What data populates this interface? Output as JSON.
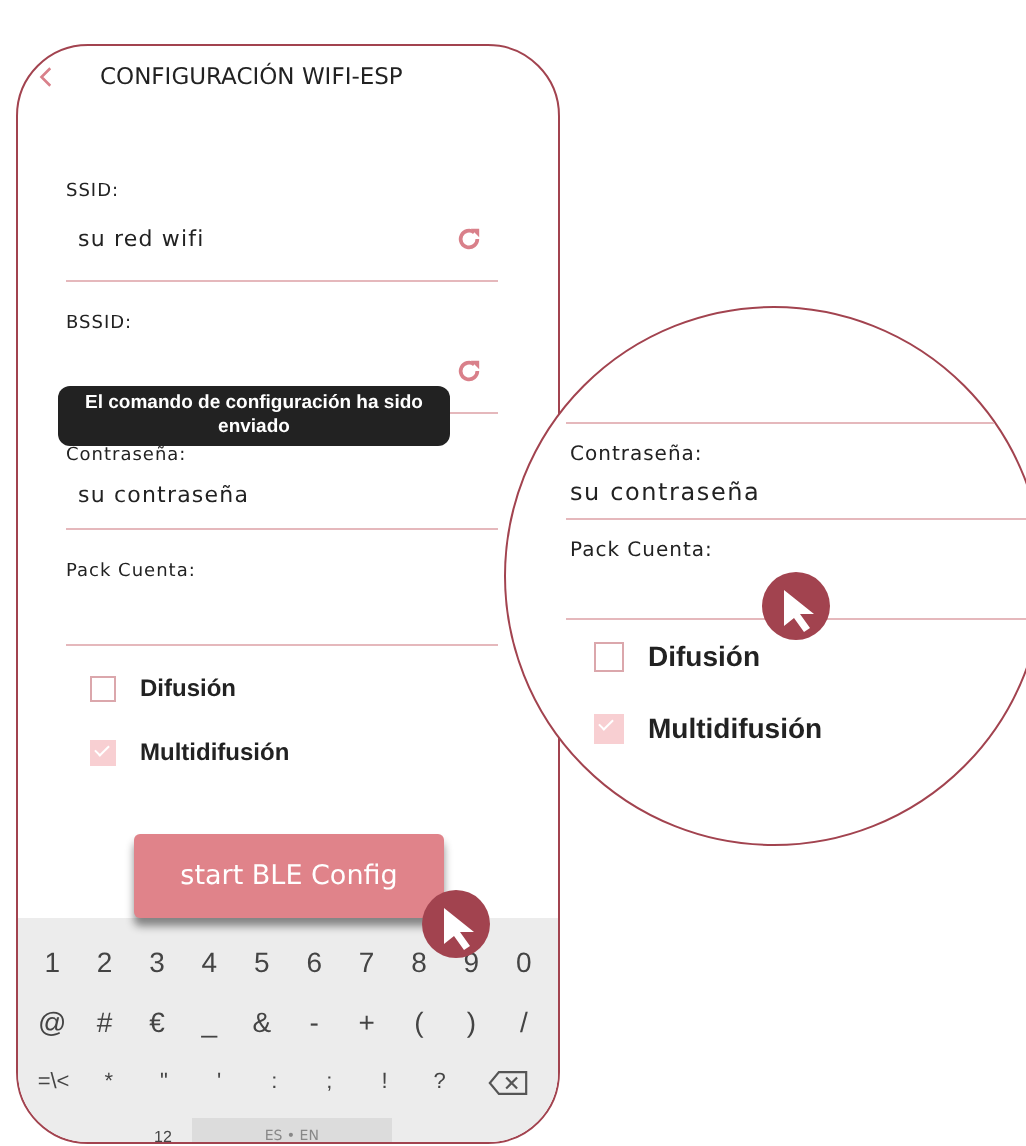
{
  "header": {
    "title": "CONFIGURACIÓN WIFI-ESP"
  },
  "fields": [
    {
      "kind": "scan",
      "label": "SSID:",
      "value": "su red wifi"
    },
    {
      "kind": "scan",
      "label": "BSSID:"
    },
    {
      "kind": "text",
      "label": "Contraseña:",
      "value": "su contraseña"
    },
    {
      "kind": "text",
      "label": "Pack Cuenta:"
    }
  ],
  "toast": "El comando de configuración ha sido enviado",
  "checkboxes": [
    {
      "label": "Difusión",
      "checked": false
    },
    {
      "label": "Multidifusión",
      "checked": true
    }
  ],
  "button": "start BLE Config",
  "keyboard": {
    "rows": [
      [
        {
          "kind": "char",
          "label": "1"
        },
        {
          "kind": "char",
          "label": "2"
        },
        {
          "kind": "char",
          "label": "3"
        },
        {
          "kind": "char",
          "label": "4"
        },
        {
          "kind": "char",
          "label": "5"
        },
        {
          "kind": "char",
          "label": "6"
        },
        {
          "kind": "char",
          "label": "7"
        },
        {
          "kind": "char",
          "label": "8"
        },
        {
          "kind": "char",
          "label": "9"
        },
        {
          "kind": "char",
          "label": "0"
        }
      ],
      [
        {
          "kind": "char",
          "label": "@"
        },
        {
          "kind": "char",
          "label": "#"
        },
        {
          "kind": "char",
          "label": "€"
        },
        {
          "kind": "char",
          "label": "_"
        },
        {
          "kind": "char",
          "label": "&"
        },
        {
          "kind": "char",
          "label": "-"
        },
        {
          "kind": "char",
          "label": "+"
        },
        {
          "kind": "char",
          "label": "("
        },
        {
          "kind": "char",
          "label": ")"
        },
        {
          "kind": "char",
          "label": "/"
        }
      ],
      [
        {
          "kind": "char",
          "label": "=\\<"
        },
        {
          "kind": "char",
          "label": "*"
        },
        {
          "kind": "char",
          "label": "\""
        },
        {
          "kind": "char",
          "label": "'"
        },
        {
          "kind": "char",
          "label": ":"
        },
        {
          "kind": "char",
          "label": ";"
        },
        {
          "kind": "char",
          "label": "!"
        },
        {
          "kind": "char",
          "label": "?"
        },
        {
          "kind": "backspace"
        }
      ]
    ],
    "bottom_keys": [
      {
        "kind": "char",
        "label": "12"
      },
      {
        "kind": "space",
        "label": "ES • EN"
      }
    ]
  },
  "magnifier": {
    "fields": [
      {
        "label": "Contraseña:",
        "value": "su contraseña"
      },
      {
        "label": "Pack Cuenta:"
      }
    ],
    "checkboxes": [
      {
        "label": "Difusión",
        "checked": false
      },
      {
        "label": "Multidifusión",
        "checked": true
      }
    ]
  }
}
